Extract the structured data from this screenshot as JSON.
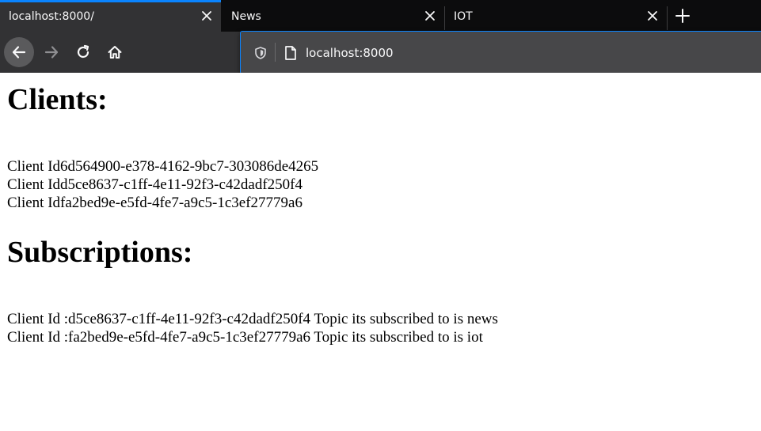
{
  "browser": {
    "tabs": [
      {
        "title": "localhost:8000/",
        "active": true
      },
      {
        "title": "News",
        "active": false
      },
      {
        "title": "IOT",
        "active": false
      }
    ],
    "url": "localhost:8000",
    "colors": {
      "tabstrip_bg": "#0c0c0d",
      "toolbar_bg": "#323234",
      "accent": "#0a84ff",
      "urlbar_bg": "#474749"
    },
    "icons": [
      "close-icon",
      "plus-icon",
      "back-arrow-icon",
      "forward-arrow-icon",
      "reload-icon",
      "home-icon",
      "shield-icon",
      "page-icon"
    ]
  },
  "page": {
    "clients_heading": "Clients:",
    "clients": [
      "Client Id6d564900-e378-4162-9bc7-303086de4265",
      "Client Idd5ce8637-c1ff-4e11-92f3-c42dadf250f4",
      "Client Idfa2bed9e-e5fd-4fe7-a9c5-1c3ef27779a6"
    ],
    "subscriptions_heading": "Subscriptions:",
    "subscriptions": [
      "Client Id :d5ce8637-c1ff-4e11-92f3-c42dadf250f4 Topic its subscribed to is news",
      "Client Id :fa2bed9e-e5fd-4fe7-a9c5-1c3ef27779a6 Topic its subscribed to is iot"
    ]
  }
}
